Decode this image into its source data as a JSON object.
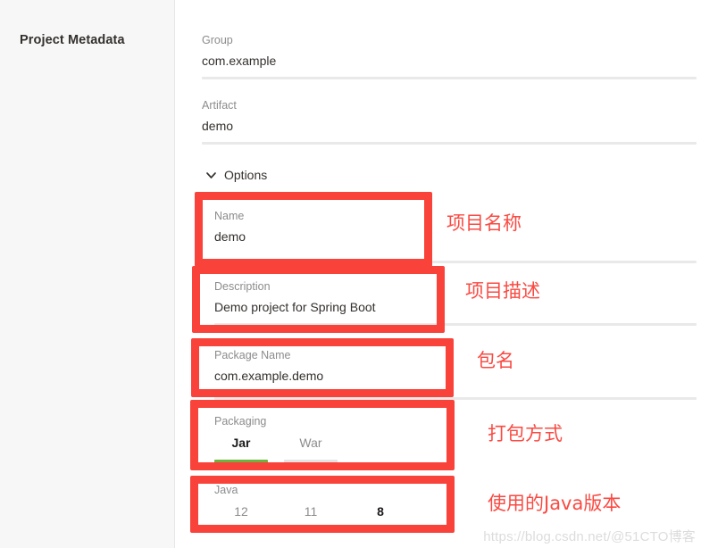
{
  "sidebar": {
    "title": "Project Metadata"
  },
  "options_toggle": {
    "label": "Options",
    "chevron_icon": "chevron-down-icon",
    "expanded": true
  },
  "outer_fields": [
    {
      "label": "Group",
      "value": "com.example"
    },
    {
      "label": "Artifact",
      "value": "demo"
    }
  ],
  "inner_fields": [
    {
      "label": "Name",
      "value": "demo"
    },
    {
      "label": "Description",
      "value": "Demo project for Spring Boot"
    },
    {
      "label": "Package Name",
      "value": "com.example.demo"
    }
  ],
  "radio_groups": [
    {
      "label": "Packaging",
      "options": [
        {
          "text": "Jar",
          "selected": true
        },
        {
          "text": "War",
          "selected": false
        }
      ]
    },
    {
      "label": "Java",
      "options": [
        {
          "text": "12",
          "selected": false
        },
        {
          "text": "11",
          "selected": false
        },
        {
          "text": "8",
          "selected": true
        }
      ]
    }
  ],
  "annotations": [
    {
      "text": "项目名称"
    },
    {
      "text": "项目描述"
    },
    {
      "text": "包名"
    },
    {
      "text": "打包方式"
    },
    {
      "text": "使用的Java版本"
    }
  ],
  "watermark": {
    "text": "https://blog.csdn.net/@51CTO博客"
  },
  "colors": {
    "annotation_red": "#f9423a",
    "selected_green": "#6db33f",
    "sidebar_bg": "#f7f7f7",
    "label_gray": "#8c8c8c",
    "value_dark": "#34302d"
  }
}
